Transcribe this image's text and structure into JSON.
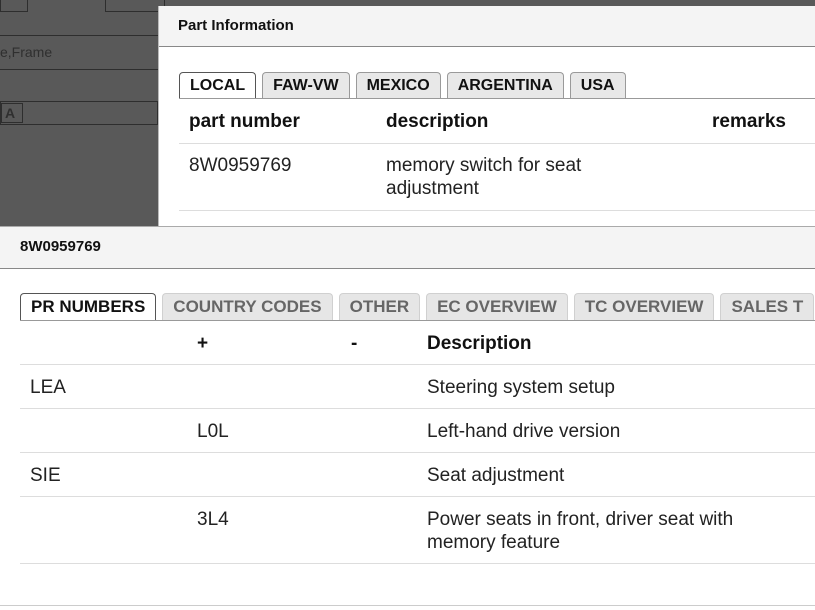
{
  "background": {
    "field_text": "e,Frame",
    "font_icon": "A"
  },
  "part_dialog": {
    "title": "Part Information",
    "tabs": [
      "LOCAL",
      "FAW-VW",
      "MEXICO",
      "ARGENTINA",
      "USA"
    ],
    "active_tab": "LOCAL",
    "columns": [
      "part number",
      "description",
      "remarks"
    ],
    "rows": [
      {
        "part_number": "8W0959769",
        "description_line1": "memory switch for seat",
        "description_line2": "adjustment",
        "remarks": ""
      }
    ]
  },
  "pr_dialog": {
    "title": "8W0959769",
    "tabs": [
      "PR NUMBERS",
      "COUNTRY CODES",
      "OTHER",
      "EC OVERVIEW",
      "TC OVERVIEW",
      "SALES T"
    ],
    "active_tab": "PR NUMBERS",
    "columns": [
      "",
      "+",
      "-",
      "Description"
    ],
    "rows": [
      {
        "family": "LEA",
        "plus": "",
        "minus": "",
        "description_line1": "Steering system setup",
        "description_line2": ""
      },
      {
        "family": "",
        "plus": "L0L",
        "minus": "",
        "description_line1": "Left-hand drive version",
        "description_line2": ""
      },
      {
        "family": "SIE",
        "plus": "",
        "minus": "",
        "description_line1": "Seat adjustment",
        "description_line2": ""
      },
      {
        "family": "",
        "plus": "3L4",
        "minus": "",
        "description_line1": "Power seats in front, driver seat with",
        "description_line2": "memory feature"
      }
    ]
  }
}
